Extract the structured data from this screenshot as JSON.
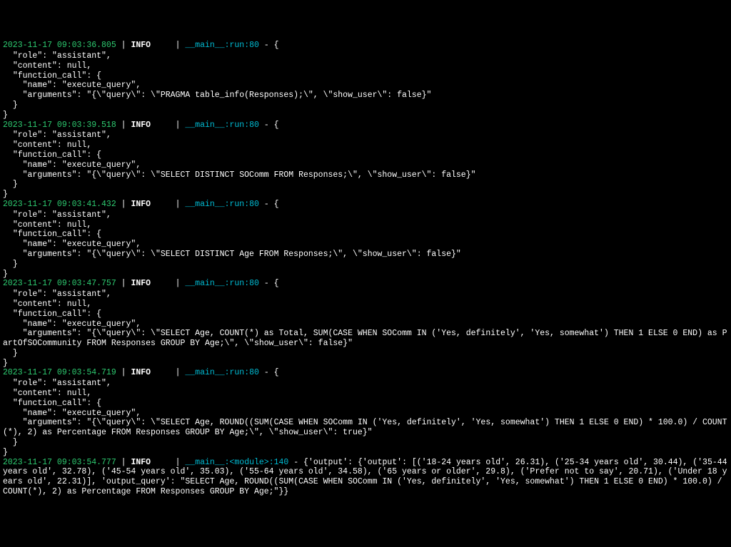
{
  "entries": [
    {
      "ts": "2023-11-17 09:03:36.805",
      "level": "INFO",
      "loc": "__main__:run:80",
      "inline": "{",
      "body": "  \"role\": \"assistant\",\n  \"content\": null,\n  \"function_call\": {\n    \"name\": \"execute_query\",\n    \"arguments\": \"{\\\"query\\\": \\\"PRAGMA table_info(Responses);\\\", \\\"show_user\\\": false}\"\n  }\n}"
    },
    {
      "ts": "2023-11-17 09:03:39.518",
      "level": "INFO",
      "loc": "__main__:run:80",
      "inline": "{",
      "body": "  \"role\": \"assistant\",\n  \"content\": null,\n  \"function_call\": {\n    \"name\": \"execute_query\",\n    \"arguments\": \"{\\\"query\\\": \\\"SELECT DISTINCT SOComm FROM Responses;\\\", \\\"show_user\\\": false}\"\n  }\n}"
    },
    {
      "ts": "2023-11-17 09:03:41.432",
      "level": "INFO",
      "loc": "__main__:run:80",
      "inline": "{",
      "body": "  \"role\": \"assistant\",\n  \"content\": null,\n  \"function_call\": {\n    \"name\": \"execute_query\",\n    \"arguments\": \"{\\\"query\\\": \\\"SELECT DISTINCT Age FROM Responses;\\\", \\\"show_user\\\": false}\"\n  }\n}"
    },
    {
      "ts": "2023-11-17 09:03:47.757",
      "level": "INFO",
      "loc": "__main__:run:80",
      "inline": "{",
      "body": "  \"role\": \"assistant\",\n  \"content\": null,\n  \"function_call\": {\n    \"name\": \"execute_query\",\n    \"arguments\": \"{\\\"query\\\": \\\"SELECT Age, COUNT(*) as Total, SUM(CASE WHEN SOComm IN ('Yes, definitely', 'Yes, somewhat') THEN 1 ELSE 0 END) as PartOfSOCommunity FROM Responses GROUP BY Age;\\\", \\\"show_user\\\": false}\"\n  }\n}"
    },
    {
      "ts": "2023-11-17 09:03:54.719",
      "level": "INFO",
      "loc": "__main__:run:80",
      "inline": "{",
      "body": "  \"role\": \"assistant\",\n  \"content\": null,\n  \"function_call\": {\n    \"name\": \"execute_query\",\n    \"arguments\": \"{\\\"query\\\": \\\"SELECT Age, ROUND((SUM(CASE WHEN SOComm IN ('Yes, definitely', 'Yes, somewhat') THEN 1 ELSE 0 END) * 100.0) / COUNT(*), 2) as Percentage FROM Responses GROUP BY Age;\\\", \\\"show_user\\\": true}\"\n  }\n}"
    },
    {
      "ts": "2023-11-17 09:03:54.777",
      "level": "INFO",
      "loc": "__main__:<module>:140",
      "inline": "{'output': {'output': [('18-24 years old', 26.31), ('25-34 years old', 30.44), ('35-44 years old', 32.78), ('45-54 years old', 35.03), ('55-64 years old', 34.58), ('65 years or older', 29.8), ('Prefer not to say', 20.71), ('Under 18 years old', 22.31)], 'output_query': \"SELECT Age, ROUND((SUM(CASE WHEN SOComm IN ('Yes, definitely', 'Yes, somewhat') THEN 1 ELSE 0 END) * 100.0) / COUNT(*), 2) as Percentage FROM Responses GROUP BY Age;\"}}",
      "body": ""
    }
  ],
  "sep": " | ",
  "dash": " - "
}
